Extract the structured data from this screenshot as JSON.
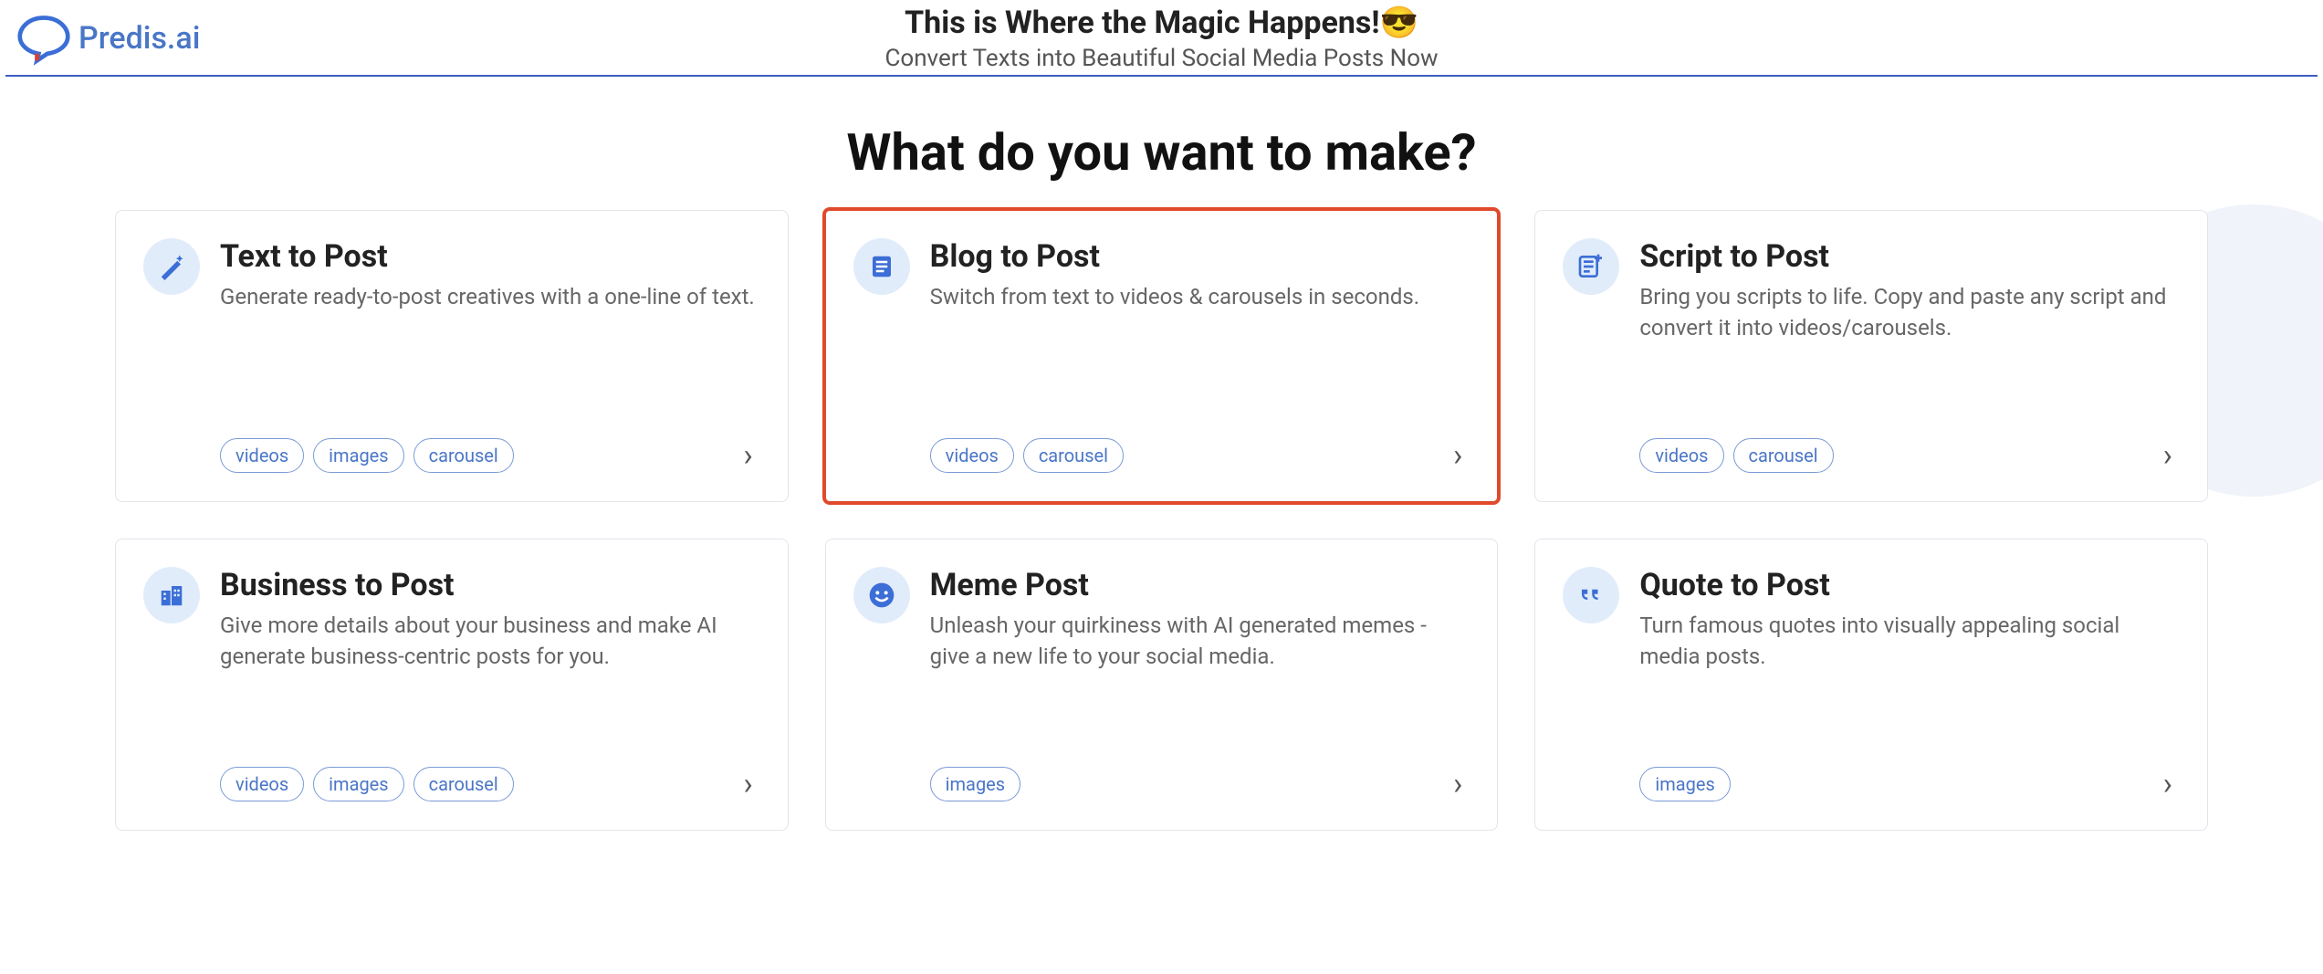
{
  "header": {
    "brand": "Predis.ai",
    "title": "This is Where the Magic Happens!😎",
    "subtitle": "Convert Texts into Beautiful Social Media Posts Now"
  },
  "page_title": "What do you want to make?",
  "cards": [
    {
      "icon": "magic-wand-icon",
      "title": "Text to Post",
      "desc": "Generate ready-to-post creatives with a one-line of text.",
      "tags": [
        "videos",
        "images",
        "carousel"
      ],
      "highlighted": false
    },
    {
      "icon": "document-icon",
      "title": "Blog to Post",
      "desc": "Switch from text to videos & carousels in seconds.",
      "tags": [
        "videos",
        "carousel"
      ],
      "highlighted": true
    },
    {
      "icon": "script-plus-icon",
      "title": "Script to Post",
      "desc": "Bring you scripts to life. Copy and paste any script and convert it into videos/carousels.",
      "tags": [
        "videos",
        "carousel"
      ],
      "highlighted": false
    },
    {
      "icon": "buildings-icon",
      "title": "Business to Post",
      "desc": "Give more details about your business and make AI generate business-centric posts for you.",
      "tags": [
        "videos",
        "images",
        "carousel"
      ],
      "highlighted": false
    },
    {
      "icon": "smiley-icon",
      "title": "Meme Post",
      "desc": "Unleash your quirkiness with AI generated memes - give a new life to your social media.",
      "tags": [
        "images"
      ],
      "highlighted": false
    },
    {
      "icon": "quotes-icon",
      "title": "Quote to Post",
      "desc": "Turn famous quotes into visually appealing social media posts.",
      "tags": [
        "images"
      ],
      "highlighted": false
    }
  ]
}
